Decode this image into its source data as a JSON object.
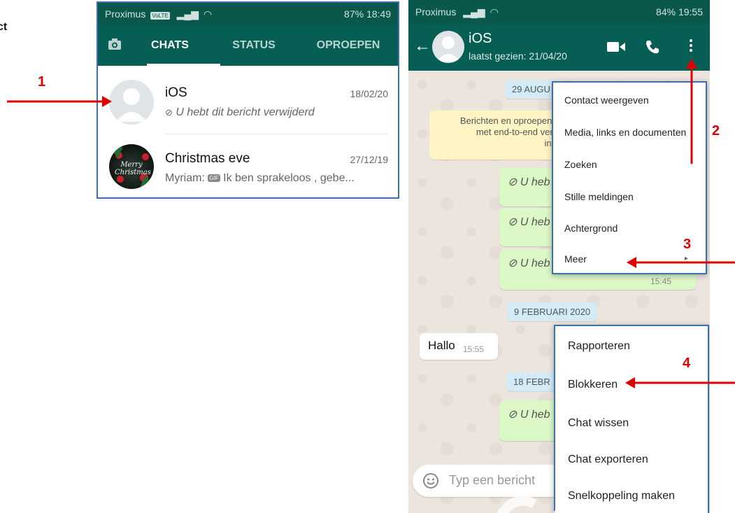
{
  "stray_text": "ct",
  "annotations": {
    "n1": "1",
    "n2": "2",
    "n3": "3",
    "n4": "4"
  },
  "left_phone": {
    "status": {
      "carrier": "Proximus",
      "network": "VoLTE",
      "battery_time": "87% 18:49"
    },
    "tabs": [
      {
        "label": "CHATS",
        "active": true
      },
      {
        "label": "STATUS",
        "active": false
      },
      {
        "label": "OPROEPEN",
        "active": false
      }
    ],
    "chats": [
      {
        "name": "iOS",
        "date": "18/02/20",
        "message": "U hebt dit bericht verwijderd",
        "icon": "blocked-icon"
      },
      {
        "name": "Christmas eve",
        "date": "27/12/19",
        "sender": "Myriam:",
        "badge": "GIF",
        "message": "Ik ben sprakeloos , gebe...",
        "avatar_text": "Merry Christmas"
      }
    ]
  },
  "right_phone": {
    "status": {
      "carrier": "Proximus",
      "battery_time": "84% 19:55"
    },
    "contact": {
      "name": "iOS",
      "last_seen": "laatst gezien: 21/04/20"
    },
    "chat": {
      "date_chip_1": "29 AUGU",
      "encryption_notice": [
        "Berichten en oproepen ir",
        "met end-to-end vers",
        "info"
      ],
      "deleted_1": "U heb",
      "deleted_2": "U heb",
      "deleted_3": "U heb",
      "time_1": "15:45",
      "date_chip_2": "9 FEBRUARI 2020",
      "incoming_text": "Hallo",
      "incoming_time": "15:55",
      "date_chip_3": "18 FEBR",
      "deleted_4": "U heb",
      "input_placeholder": "Typ een bericht"
    },
    "menu_1": [
      "Contact weergeven",
      "Media, links en documenten",
      "Zoeken",
      "Stille meldingen",
      "Achtergrond",
      "Meer"
    ],
    "menu_2": [
      "Rapporteren",
      "Blokkeren",
      "Chat wissen",
      "Chat exporteren",
      "Snelkoppeling maken"
    ]
  },
  "colors": {
    "whatsapp_dark": "#075e54",
    "annotation_red": "#e00000",
    "bubble_green": "#dcf8c6"
  }
}
